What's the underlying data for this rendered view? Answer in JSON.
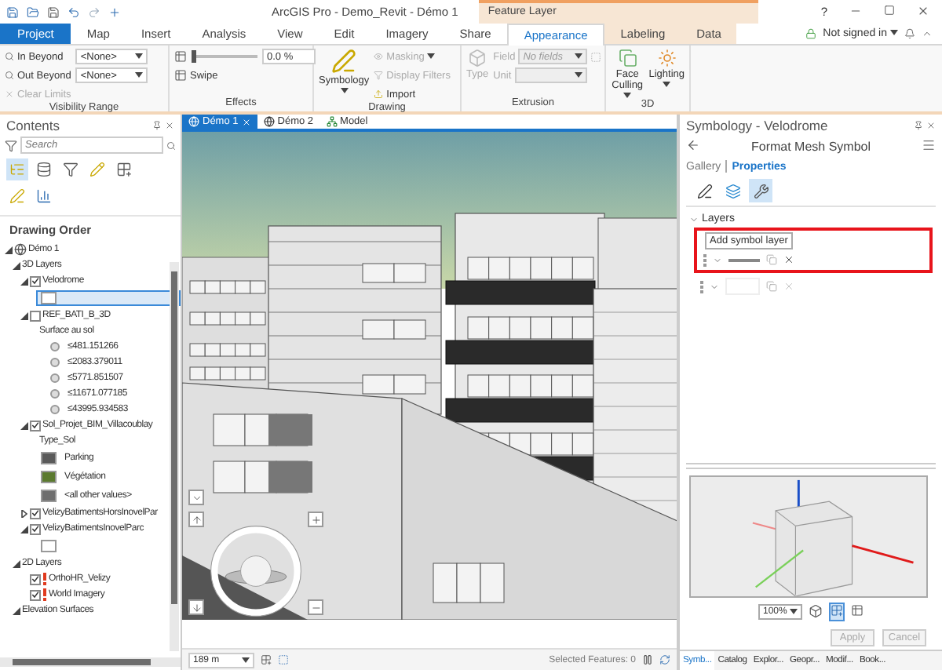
{
  "window": {
    "title": "ArcGIS Pro - Demo_Revit - Démo 1",
    "contextual_tab_group": "Feature Layer",
    "help": "?"
  },
  "ribbon_tabs": [
    {
      "label": "Project",
      "kind": "file",
      "contextual": false,
      "selected": false
    },
    {
      "label": "Map",
      "kind": "tab",
      "contextual": false,
      "selected": false
    },
    {
      "label": "Insert",
      "kind": "tab",
      "contextual": false,
      "selected": false
    },
    {
      "label": "Analysis",
      "kind": "tab",
      "contextual": false,
      "selected": false
    },
    {
      "label": "View",
      "kind": "tab",
      "contextual": false,
      "selected": false
    },
    {
      "label": "Edit",
      "kind": "tab",
      "contextual": false,
      "selected": false
    },
    {
      "label": "Imagery",
      "kind": "tab",
      "contextual": false,
      "selected": false
    },
    {
      "label": "Share",
      "kind": "tab",
      "contextual": false,
      "selected": false
    },
    {
      "label": "Appearance",
      "kind": "tab",
      "contextual": true,
      "selected": true
    },
    {
      "label": "Labeling",
      "kind": "tab",
      "contextual": true,
      "selected": false
    },
    {
      "label": "Data",
      "kind": "tab",
      "contextual": true,
      "selected": false
    }
  ],
  "account": {
    "label": "Not signed in"
  },
  "ribbon": {
    "visibility_range": {
      "title": "Visibility Range",
      "in_beyond": {
        "label": "In Beyond",
        "value": "<None>"
      },
      "out_beyond": {
        "label": "Out Beyond",
        "value": "<None>"
      },
      "clear_limits": {
        "label": "Clear Limits",
        "disabled": true
      }
    },
    "effects": {
      "title": "Effects",
      "transparency": {
        "level": 0,
        "reading": "0.0 %"
      },
      "swipe": "Swipe"
    },
    "drawing": {
      "title": "Drawing",
      "symbology": "Symbology",
      "masking": {
        "label": "Masking",
        "disabled": true
      },
      "display_filters": {
        "label": "Display Filters",
        "disabled": true
      },
      "import": {
        "label": "Import",
        "disabled": false
      }
    },
    "extrusion": {
      "title": "Extrusion",
      "type": {
        "label": "Type",
        "disabled": true
      },
      "field": {
        "label": "Field",
        "value": "No fields",
        "disabled": true
      },
      "unit": {
        "label": "Unit",
        "disabled": true
      }
    },
    "three_d": {
      "title": "3D",
      "face_culling": "Face Culling",
      "lighting": "Lighting"
    }
  },
  "contents": {
    "title": "Contents",
    "search": {
      "placeholder": "Search"
    },
    "heading": "Drawing Order",
    "tree": [
      {
        "kind": "map",
        "label": "Démo 1",
        "expanded": true,
        "children": [
          {
            "kind": "group",
            "label": "3D Layers",
            "expanded": true,
            "children": [
              {
                "kind": "layer",
                "label": "Velodrome",
                "expanded": true,
                "checked": true,
                "warning": false,
                "children": [
                  {
                    "kind": "fill_class",
                    "color": "#ffffff",
                    "selected": true
                  }
                ]
              },
              {
                "kind": "layer",
                "label": "REF_BATI_B_3D",
                "expanded": true,
                "checked": false,
                "warning": false,
                "children": [
                  {
                    "kind": "heading",
                    "label": "Surface au sol"
                  },
                  {
                    "kind": "point_class",
                    "label": "≤481.151266",
                    "color": "#dcdcdc",
                    "selected": false
                  },
                  {
                    "kind": "point_class",
                    "label": "≤2083.379011",
                    "color": "#dcdcdc",
                    "selected": false
                  },
                  {
                    "kind": "point_class",
                    "label": "≤5771.851507",
                    "color": "#dcdcdc",
                    "selected": false
                  },
                  {
                    "kind": "point_class",
                    "label": "≤11671.077185",
                    "color": "#dcdcdc",
                    "selected": false
                  },
                  {
                    "kind": "point_class",
                    "label": "≤43995.934583",
                    "color": "#dcdcdc",
                    "selected": false
                  }
                ]
              },
              {
                "kind": "layer",
                "label": "Sol_Projet_BIM_Villacoublay",
                "expanded": true,
                "checked": true,
                "warning": false,
                "children": [
                  {
                    "kind": "heading",
                    "label": "Type_Sol"
                  },
                  {
                    "kind": "fill_class",
                    "label": "Parking",
                    "color": "#5a5a5a",
                    "selected": false
                  },
                  {
                    "kind": "fill_class",
                    "label": "Végétation",
                    "color": "#5b7a2f",
                    "selected": false
                  },
                  {
                    "kind": "fill_class",
                    "label": "<all other values>",
                    "color": "#6e6e6e",
                    "selected": false
                  }
                ]
              },
              {
                "kind": "layer",
                "label": "VelizyBatimentsHorsInovelPar",
                "expanded": false,
                "checked": true,
                "warning": false
              },
              {
                "kind": "layer",
                "label": "VelizyBatimentsInovelParc",
                "expanded": true,
                "checked": true,
                "warning": false,
                "children": [
                  {
                    "kind": "fill_class",
                    "color": "#ffffff",
                    "selected": false
                  }
                ]
              }
            ]
          },
          {
            "kind": "group",
            "label": "2D Layers",
            "expanded": true,
            "children": [
              {
                "kind": "layer",
                "label": "OrthoHR_Velizy",
                "checked": true,
                "warning": true
              },
              {
                "kind": "layer",
                "label": "World Imagery",
                "checked": true,
                "warning": true
              }
            ]
          },
          {
            "kind": "group",
            "label": "Elevation Surfaces",
            "expanded": true
          }
        ]
      }
    ]
  },
  "map_view": {
    "tabs": [
      {
        "label": "Démo 1",
        "kind": "scene",
        "selected": true
      },
      {
        "label": "Démo 2",
        "kind": "scene",
        "selected": false
      },
      {
        "label": "Model",
        "kind": "model",
        "selected": false
      }
    ],
    "scale": "189 m",
    "selected_features": "Selected Features: 0"
  },
  "symbology": {
    "title": "Symbology - Velodrome",
    "header": "Format Mesh Symbol",
    "tabs": [
      {
        "label": "Gallery",
        "selected": false
      },
      {
        "label": "Properties",
        "selected": true
      }
    ],
    "icon_tabs": [
      {
        "kind": "pen",
        "selected": false
      },
      {
        "kind": "layers",
        "selected": false
      },
      {
        "kind": "wrench",
        "selected": true
      }
    ],
    "section": {
      "label": "Layers",
      "expanded": true
    },
    "tooltip": "Add symbol layer",
    "symbol_layers": [
      {
        "kind": "stroke",
        "highlighted": true
      },
      {
        "kind": "fill",
        "highlighted": false
      }
    ],
    "preview_zoom": "100%",
    "buttons": [
      {
        "label": "Apply",
        "disabled": true
      },
      {
        "label": "Cancel",
        "disabled": true
      }
    ],
    "bottom_tabs": [
      {
        "label": "Symb...",
        "selected": true
      },
      {
        "label": "Catalog",
        "selected": false
      },
      {
        "label": "Explor...",
        "selected": false
      },
      {
        "label": "Geopr...",
        "selected": false
      },
      {
        "label": "Modif...",
        "selected": false
      },
      {
        "label": "Book...",
        "selected": false
      }
    ]
  }
}
